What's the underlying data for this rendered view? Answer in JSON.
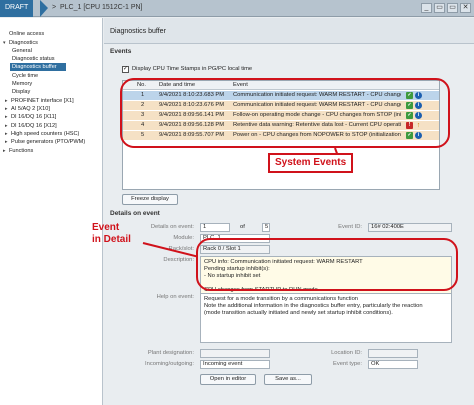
{
  "titlebar": {
    "draft": "DRAFT",
    "separator": ">",
    "plc": "PLC_1 [CPU 1512C-1 PN]",
    "win_buttons": [
      "_",
      "▭",
      "▭",
      "✕"
    ]
  },
  "tree": {
    "items": [
      {
        "label": "Online access",
        "toggle": ""
      },
      {
        "label": "Diagnostics",
        "toggle": "▾"
      },
      {
        "label": "General",
        "toggle": ""
      },
      {
        "label": "Diagnostic status",
        "toggle": ""
      },
      {
        "label": "Diagnostics buffer",
        "toggle": ""
      },
      {
        "label": "Cycle time",
        "toggle": ""
      },
      {
        "label": "Memory",
        "toggle": ""
      },
      {
        "label": "Display",
        "toggle": ""
      },
      {
        "label": "PROFINET interface [X1]",
        "toggle": "▸"
      },
      {
        "label": "AI 5/AQ 2 [X10]",
        "toggle": "▸"
      },
      {
        "label": "DI 16/DQ 16 [X11]",
        "toggle": "▸"
      },
      {
        "label": "DI 16/DQ 16 [X12]",
        "toggle": "▸"
      },
      {
        "label": "High speed counters (HSC)",
        "toggle": "▸"
      },
      {
        "label": "Pulse generators (PTO/PWM)",
        "toggle": "▸"
      },
      {
        "label": "Functions",
        "toggle": "▸"
      }
    ]
  },
  "pane": {
    "title": "Diagnostics buffer",
    "events_heading": "Events",
    "checkbox_label": "Display CPU Time Stamps in PG/PC local time",
    "checkbox_mark": "✓"
  },
  "grid": {
    "headers": {
      "no": "No.",
      "date": "Date and time",
      "event": "Event"
    },
    "rows": [
      {
        "no": "1",
        "date": "9/4/2021 8:10:23.683 PM",
        "event": "Communication initiated request: WARM RESTART - CPU changes from..."
      },
      {
        "no": "2",
        "date": "9/4/2021 8:10:23.676 PM",
        "event": "Communication initiated request: WARM RESTART - CPU changes from..."
      },
      {
        "no": "3",
        "date": "9/4/2021 8:09:56.141 PM",
        "event": "Follow-on operating mode change - CPU changes from STOP (initializa..."
      },
      {
        "no": "4",
        "date": "9/4/2021 8:09:56.128 PM",
        "event": "Retentive data warning: Retentive data lost - Current CPU operating m..."
      },
      {
        "no": "5",
        "date": "9/4/2021 8:09:55.707 PM",
        "event": "Power on - CPU changes from NOPOWER to STOP (initialization) mode"
      }
    ]
  },
  "buttons": {
    "freeze": "Freeze display",
    "open_editor": "Open in editor",
    "save_as": "Save as..."
  },
  "details": {
    "heading": "Details on event",
    "labels": {
      "details_on_event": "Details on event:",
      "module": "Module:",
      "rack": "Rack/slot:",
      "description": "Description:",
      "help": "Help on event:",
      "plant": "Plant designation:",
      "incoming": "Incoming/outgoing:",
      "event_id": "Event ID:",
      "location_id": "Location ID:",
      "event_type": "Event type:"
    },
    "values": {
      "event_no": "1",
      "of": "of",
      "total": "5",
      "event_id": "16# 02:400E",
      "module": "PLC_1",
      "rack": "Rack 0 / Slot 1",
      "description": [
        "CPU info: Communication initiated request: WARM RESTART",
        "Pending startup inhibit(s):",
        "- No startup inhibit set",
        "",
        "CPU changes from STARTUP to RUN mode"
      ],
      "help": [
        "Request for a mode transition by a communications function",
        "Note the additional information in the diagnostics buffer entry, particularly the reaction",
        "(mode transition actually initiated and newly set startup inhibit conditions)."
      ],
      "plant": "",
      "location_id": "",
      "incoming": "Incoming event",
      "event_type": "OK"
    }
  },
  "annotations": {
    "system_events": "System Events",
    "event_detail_1": "Event",
    "event_detail_2": "in Detail"
  },
  "colors": {
    "accent_red": "#d0121b",
    "selected_blue": "#2f6fa0",
    "row_orange": "#f5e1c5"
  }
}
